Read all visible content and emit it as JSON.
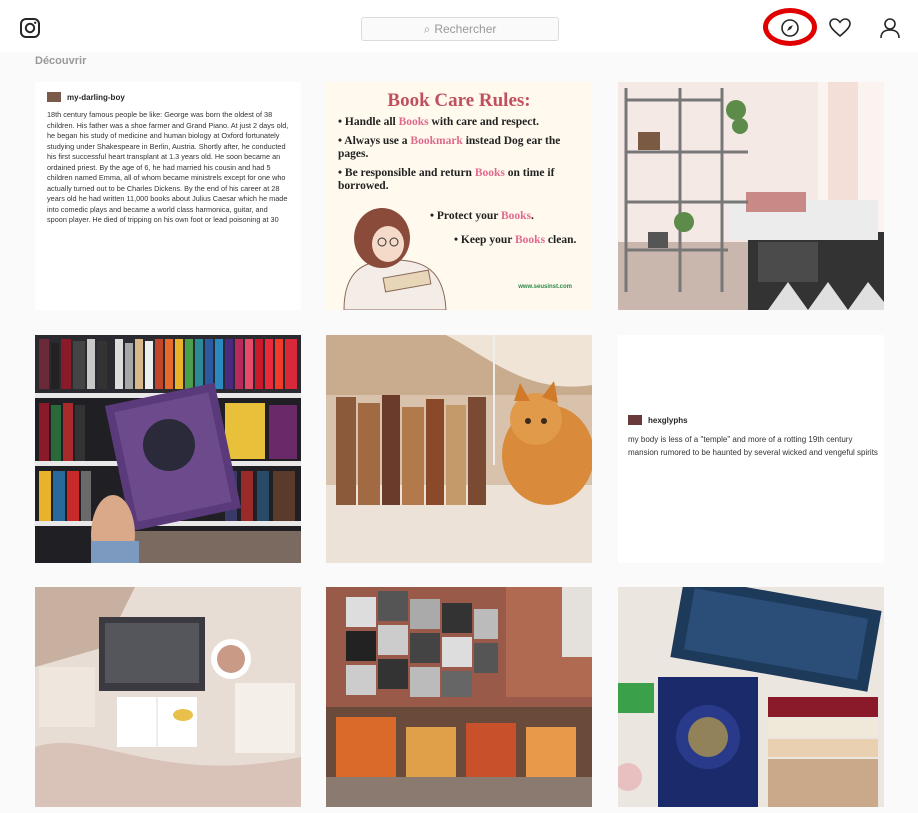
{
  "header": {
    "search_placeholder": "Rechercher"
  },
  "section": {
    "title": "Découvrir"
  },
  "posts": {
    "text1": {
      "username": "my-darling-boy",
      "body": "18th century famous people be like: George was born the oldest of 38 children. His father was a shoe farmer and Grand Piano. At just 2 days old, he began his study of medicine and human biology at Oxford fortunately studying under Shakespeare in Berlin, Austria. Shortly after, he conducted his first successful heart transplant at 1.3 years old. He soon became an ordained priest. By the age of 6, he had married his cousin and had 5 children named Emma, all of whom became ministrels except for one who actually turned out to be Charles Dickens. By the end of his career at 28 years old he had written 11,000 books about Julius Caesar which he made into comedic plays and became a world class harmonica, guitar, and spoon player. He died of tripping on his own foot or lead poisoning at 30"
    },
    "rules": {
      "title": "Book Care Rules:",
      "items": [
        {
          "pre": "Handle all ",
          "hl": "Books",
          "post": " with care and respect."
        },
        {
          "pre": "Always use a ",
          "hl": "Bookmark",
          "post": " instead Dog ear the pages."
        },
        {
          "pre": "Be responsible and return ",
          "hl": "Books",
          "post": " on time if borrowed."
        },
        {
          "pre": "Protect your ",
          "hl": "Books",
          "post": "."
        },
        {
          "pre": "Keep your ",
          "hl": "Books",
          "post": " clean."
        }
      ],
      "site": "www.seusinst.com"
    },
    "text2": {
      "username": "hexglyphs",
      "body": "my body is less of a \"temple\" and more of a rotting 19th century mansion rumored to be haunted by several wicked and vengeful spirits"
    }
  },
  "colors": {
    "explore_highlight": "#e00000",
    "rule_title": "#c0505f",
    "rule_highlight": "#e06a8e"
  },
  "icons": [
    "instagram-logo-icon",
    "search-icon",
    "compass-icon",
    "heart-icon",
    "profile-icon"
  ]
}
